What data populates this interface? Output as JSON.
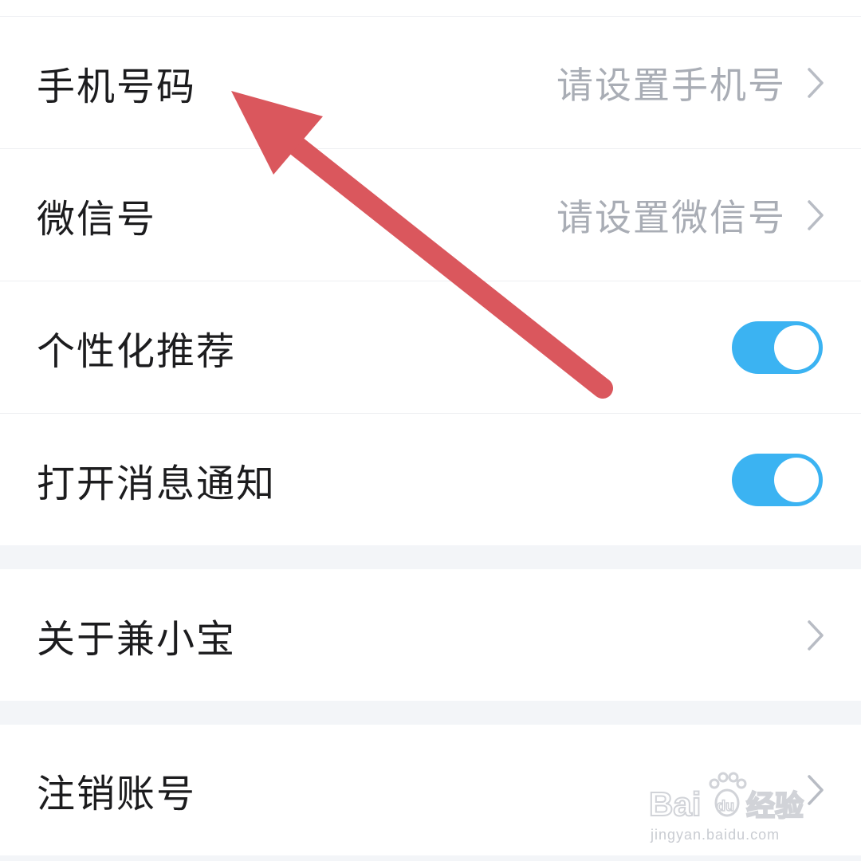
{
  "settings": {
    "rows": [
      {
        "label": "手机号码",
        "value": "请设置手机号"
      },
      {
        "label": "微信号",
        "value": "请设置微信号"
      },
      {
        "label": "个性化推荐",
        "toggle_on": true
      },
      {
        "label": "打开消息通知",
        "toggle_on": true
      },
      {
        "label": "关于兼小宝"
      },
      {
        "label": "注销账号"
      }
    ]
  },
  "colors": {
    "toggle_on": "#3bb3f2",
    "annotation_arrow": "#da575d",
    "value_text": "#a9adb5",
    "section_gap": "#f3f5f8"
  },
  "icons": {
    "row_chevron": "chevron-right-icon",
    "annotation": "red-arrow-pointer"
  },
  "watermark": {
    "brand": "Bai du 经验",
    "url": "jingyan.baidu.com"
  }
}
